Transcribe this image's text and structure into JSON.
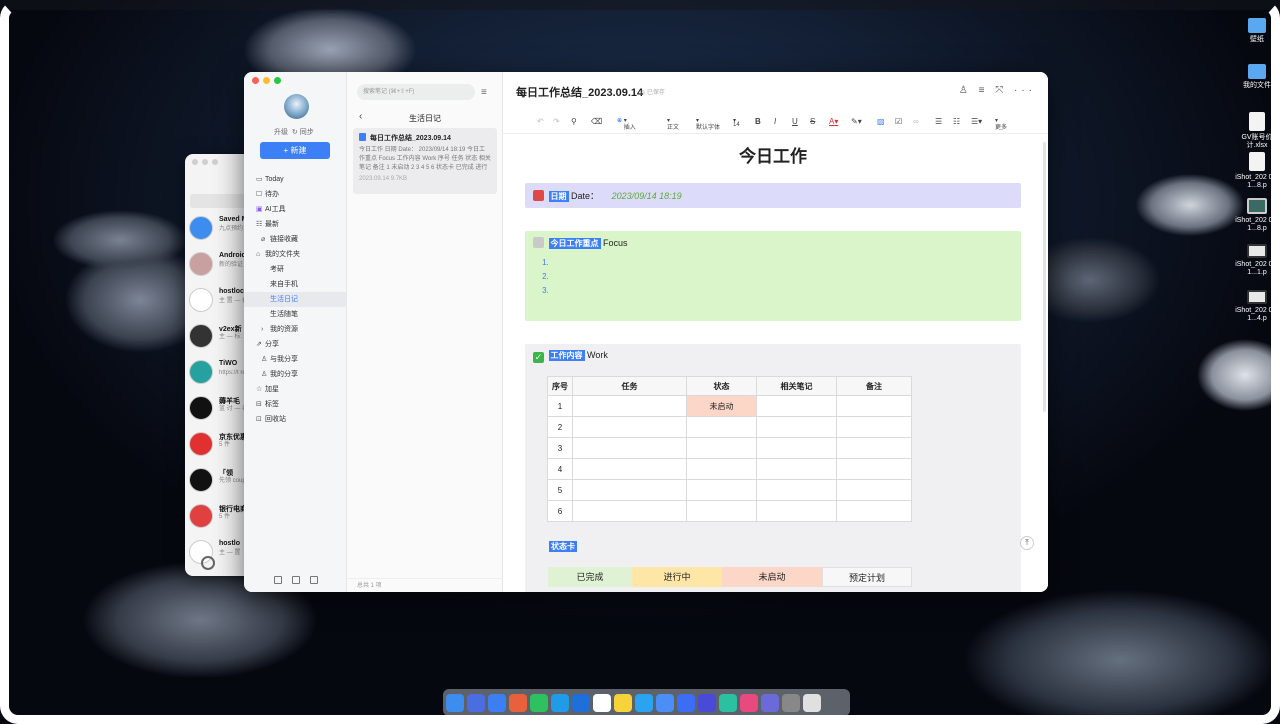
{
  "desktop": {
    "icons": [
      {
        "label": "壁纸",
        "kind": "folder"
      },
      {
        "label": "我的文件",
        "kind": "folder"
      },
      {
        "label": "GV账号价计.xlsx",
        "kind": "file"
      },
      {
        "label": "iShot_202 09-1...8.p",
        "kind": "file"
      },
      {
        "label": "iShot_202 09-1...8.p",
        "kind": "shotg"
      },
      {
        "label": "iShot_202 09-1...1.p",
        "kind": "shot"
      },
      {
        "label": "iShot_202 09-1...4.p",
        "kind": "shot"
      }
    ]
  },
  "chat": {
    "items": [
      {
        "name": "Saved M",
        "sub": "九点预约",
        "color": "#3d8df0"
      },
      {
        "name": "Androic",
        "sub": "新的验证 106822...",
        "color": "#c9a0a0"
      },
      {
        "name": "hostloc",
        "sub": "主 置 — 香: 风花",
        "color": "#ffffff"
      },
      {
        "name": "v2ex新",
        "sub": "主 — 标: 汽车",
        "color": "#333333"
      },
      {
        "name": "TiWO",
        "sub": "https://t rewimg/",
        "color": "#27a0a0"
      },
      {
        "name": "薅羊毛",
        "sub": "蓝 讨 — 者: 不要",
        "color": "#111111"
      },
      {
        "name": "京东优惠",
        "sub": "5 件",
        "color": "#e03030"
      },
      {
        "name": "「领",
        "sub": "先领 coupon",
        "color": "#111111"
      },
      {
        "name": "银行电商",
        "sub": "5 件",
        "color": "#e04040"
      },
      {
        "name": "hostlo",
        "sub": "主 — 置",
        "color": "#ffffff"
      }
    ]
  },
  "sidebar": {
    "upgrade": "升级",
    "sync": "同步",
    "new_label": "+ 新建",
    "items": [
      {
        "label": "Today",
        "icon": "▭",
        "sub": false,
        "active": false
      },
      {
        "label": "待办",
        "icon": "☐",
        "sub": false,
        "active": false
      },
      {
        "label": "AI工具",
        "icon": "▣",
        "sub": false,
        "active": false
      },
      {
        "label": "最新",
        "icon": "☷",
        "sub": false,
        "active": false
      },
      {
        "label": "链接收藏",
        "icon": "⌀",
        "sub": true,
        "active": false
      },
      {
        "label": "我的文件夹",
        "icon": "⌂",
        "sub": false,
        "active": false
      },
      {
        "label": "考研",
        "icon": "",
        "sub": true,
        "active": false
      },
      {
        "label": "来自手机",
        "icon": "",
        "sub": true,
        "active": false
      },
      {
        "label": "生活日记",
        "icon": "",
        "sub": true,
        "active": true
      },
      {
        "label": "生活随笔",
        "icon": "",
        "sub": true,
        "active": false
      },
      {
        "label": "我的资源",
        "icon": "›",
        "sub": true,
        "active": false
      },
      {
        "label": "分享",
        "icon": "⇗",
        "sub": false,
        "active": false
      },
      {
        "label": "与我分享",
        "icon": "♙",
        "sub": true,
        "active": false
      },
      {
        "label": "我的分享",
        "icon": "♙",
        "sub": true,
        "active": false
      },
      {
        "label": "加星",
        "icon": "☆",
        "sub": false,
        "active": false
      },
      {
        "label": "标签",
        "icon": "⊟",
        "sub": false,
        "active": false
      },
      {
        "label": "回收站",
        "icon": "⊡",
        "sub": false,
        "active": false
      }
    ]
  },
  "list": {
    "search_placeholder": "搜索笔记 (⌘+⇧+F)",
    "title": "生活日记",
    "card": {
      "title": "每日工作总结_2023.09.14",
      "preview": "今日工作 日期 Date： 2023/09/14 18:19 今日工作重点 Focus 工作内容 Work 序号 任务 状态 相关笔记 备注 1 未启动 2 3 4 5 6 状态卡 已完成 进行中...",
      "meta": "2023.09.14   9.7KB"
    },
    "footer": "总共 1 项"
  },
  "editor": {
    "title": "每日工作总结_2023.09.14",
    "saved": "已保存",
    "toolbar": {
      "insert": "插入",
      "style": "正文",
      "font": "默认字体",
      "size": "14",
      "more": "更多"
    },
    "heading": "今日工作",
    "date_tag": "日期",
    "date_label": "Date：",
    "date_value": "2023/09/14 18:19",
    "focus_tag": "今日工作重点",
    "focus_label": "Focus",
    "focus_items": [
      "",
      "",
      ""
    ],
    "work_tag": "工作内容",
    "work_label": "Work",
    "table": {
      "headers": [
        "序号",
        "任务",
        "状态",
        "相关笔记",
        "备注"
      ],
      "rows": [
        [
          "1",
          "",
          "未启动",
          "",
          ""
        ],
        [
          "2",
          "",
          "",
          "",
          ""
        ],
        [
          "3",
          "",
          "",
          "",
          ""
        ],
        [
          "4",
          "",
          "",
          "",
          ""
        ],
        [
          "5",
          "",
          "",
          "",
          ""
        ],
        [
          "6",
          "",
          "",
          "",
          ""
        ]
      ]
    },
    "status_tag": "状态卡",
    "status_cards": [
      {
        "label": "已完成",
        "color": "#dff3d4"
      },
      {
        "label": "进行中",
        "color": "#fde6a6"
      },
      {
        "label": "未启动",
        "color": "#fcd6c7"
      },
      {
        "label": "预定计划",
        "color": "#f7f7f7"
      }
    ]
  },
  "dock": {
    "colors": [
      "#3d8df0",
      "#4a6de0",
      "#3b7ff2",
      "#e8603c",
      "#2dc160",
      "#1f9be8",
      "#1e6fd8",
      "#ffffff",
      "#f7d23a",
      "#2aa4f0",
      "#4b8ef5",
      "#3b6df5",
      "#4a4ad8",
      "#2ac0a0",
      "#e84a80",
      "#6a6ad8",
      "#888888",
      "#e0e0e0"
    ]
  }
}
